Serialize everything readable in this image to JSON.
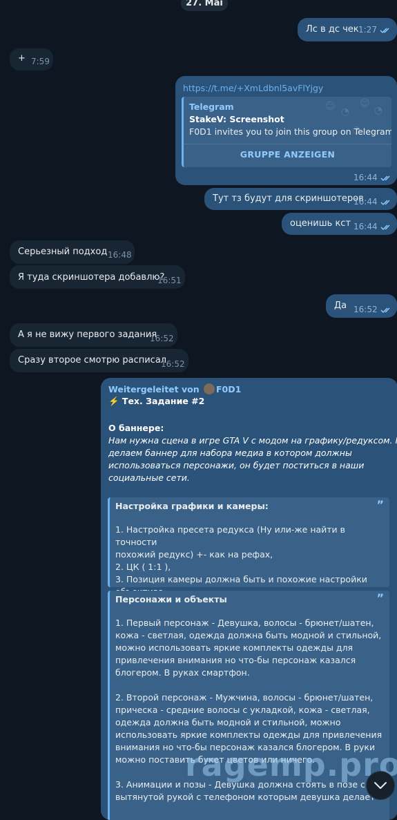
{
  "date_label": "27. Mai",
  "messages": [
    {
      "dir": "out",
      "text": "Лс в дс чек",
      "time": "1:27"
    },
    {
      "dir": "in",
      "text": "+",
      "time": "7:59"
    },
    {
      "dir": "out",
      "link": "https://t.me/+XmLdbnl5avFlYjgy",
      "preview": {
        "site": "Telegram",
        "title": "StakeV: Screenshot",
        "description": "F0D1 invites you to join this group on Telegram.",
        "button": "GRUPPE ANZEIGEN"
      },
      "time": "16:44"
    },
    {
      "dir": "out",
      "text": "Тут тз будут для скриншотеров",
      "time": "16:44"
    },
    {
      "dir": "out",
      "text": "оценишь кст",
      "time": "16:44"
    },
    {
      "dir": "in",
      "text": "Серьезный подход",
      "time": "16:48"
    },
    {
      "dir": "in",
      "text": "Я туда скриншотера добавлю?",
      "time": "16:51"
    },
    {
      "dir": "out",
      "text": "Да",
      "time": "16:52"
    },
    {
      "dir": "in",
      "text": "А я не вижу первого задания",
      "time": "16:52"
    },
    {
      "dir": "in",
      "text": "Сразу второе смотрю расписал",
      "time": "16:52"
    }
  ],
  "forwarded": {
    "prefix": "Weitergeleitet von",
    "author": "F0D1",
    "title": "⚡️ Тех. Задание #2",
    "section_title": "О баннере:",
    "section_lines": [
      "Нам нужна сцена в игре GTA V с модом на графику/редуксом. Мы",
      "делаем баннер для набора медиа в котором должны",
      "использоваться персонажи, он будет поститься в наши",
      "социальные сети."
    ],
    "quotes": [
      {
        "title": "Настройка графики и камеры:",
        "lines": [
          "1. Настройка пресета редукса (Ну или-же найти в точности",
          "похожий редукс) +- как на рефах,",
          "2. ЦК ( 1:1 ),",
          "3. Позиция камеры должна быть и похожие настройки",
          "объектива."
        ]
      },
      {
        "title": "Персонажи и объекты",
        "lines": [
          "1. Первый персонаж - Девушка, волосы - брюнет/шатен,",
          "кожа - светлая, одежда должна быть модной и стильной,",
          "можно использовать яркие комплекты одежды для",
          "привлечения внимания но что-бы персонаж казался",
          "блогером. В руках смартфон.",
          "",
          "2. Второй персонаж - Мужчина, волосы - брюнет/шатен,",
          "прическа - средние волосы с укладкой, кожа - светлая,",
          "одежда должна быть модной и стильной, можно",
          "использовать яркие комплекты одежды для привлечения",
          "внимания но что-бы персонаж казался блогером. В руки",
          "можно поставить букет цветов или ничего.",
          "",
          "3. Анимации и позы - Девушка должна стоять в позе с",
          "вытянутой рукой с телефоном которым девушка делает"
        ]
      }
    ]
  },
  "watermark": "ragemp.pro",
  "colors": {
    "background": "#0e1621",
    "outgoing": "#2b5278",
    "incoming": "#182533",
    "accent": "#6ab3f3"
  }
}
